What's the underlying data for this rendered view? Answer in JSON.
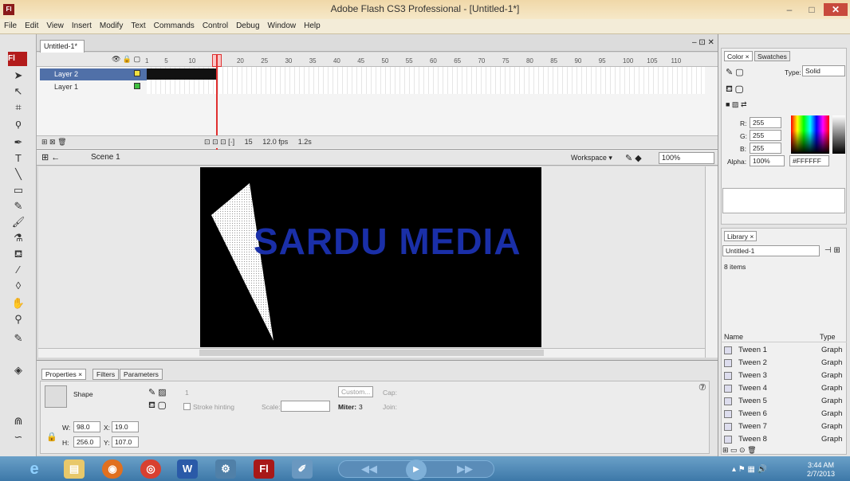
{
  "window": {
    "title": "Adobe Flash CS3 Professional - [Untitled-1*]",
    "logo": "Fl",
    "minimize": "–",
    "maximize": "□",
    "close": "✕"
  },
  "menu": [
    "File",
    "Edit",
    "View",
    "Insert",
    "Modify",
    "Text",
    "Commands",
    "Control",
    "Debug",
    "Window",
    "Help"
  ],
  "tools_logo": "Fl",
  "tools": [
    "arrow-icon",
    "subselect-icon",
    "free-transform-icon",
    "lasso-icon",
    "pen-icon",
    "text-icon",
    "line-icon",
    "rectangle-icon",
    "pencil-icon",
    "brush-icon",
    "ink-bottle-icon",
    "paint-bucket-icon",
    "eyedropper-icon",
    "eraser-icon",
    "hand-icon",
    "zoom-icon"
  ],
  "document": {
    "tab": "Untitled-1*"
  },
  "timeline": {
    "ruler": [
      "1",
      "5",
      "10",
      "15",
      "20",
      "25",
      "30",
      "35",
      "40",
      "45",
      "50",
      "55",
      "60",
      "65",
      "70",
      "75",
      "80",
      "85",
      "90",
      "95",
      "100",
      "105",
      "110"
    ],
    "layers": [
      {
        "name": "Layer 2",
        "selected": true
      },
      {
        "name": "Layer 1",
        "selected": false
      }
    ],
    "current_frame": "15",
    "fps": "12.0 fps",
    "time": "1.2s"
  },
  "scene": {
    "name": "Scene 1",
    "workspace": "Workspace ▾",
    "zoom": "100%"
  },
  "stage": {
    "text": "SARDU MEDIA",
    "text_color": "#1a2fa8",
    "background": "#000000"
  },
  "properties": {
    "tabs": [
      "Properties ×",
      "Filters",
      "Parameters"
    ],
    "type": "Shape",
    "stroke_width": "1",
    "custom_button": "Custom...",
    "cap_label": "Cap:",
    "stroke_hinting": "Stroke hinting",
    "scale_label": "Scale:",
    "miter_label": "Miter:",
    "miter_value": "3",
    "join_label": "Join:",
    "w_label": "W:",
    "w_value": "98.0",
    "x_label": "X:",
    "x_value": "19.0",
    "h_label": "H:",
    "h_value": "256.0",
    "y_label": "Y:",
    "y_value": "107.0"
  },
  "color_panel": {
    "tabs": [
      "Color ×",
      "Swatches"
    ],
    "type_label": "Type:",
    "type_value": "Solid",
    "r_label": "R:",
    "r": "255",
    "g_label": "G:",
    "g": "255",
    "b_label": "B:",
    "b": "255",
    "alpha_label": "Alpha:",
    "alpha": "100%",
    "hex": "#FFFFFF"
  },
  "library": {
    "tab": "Library ×",
    "document": "Untitled-1",
    "count": "8 items",
    "col_name": "Name",
    "col_type": "Type",
    "items": [
      {
        "name": "Tween 1",
        "type": "Graph"
      },
      {
        "name": "Tween 2",
        "type": "Graph"
      },
      {
        "name": "Tween 3",
        "type": "Graph"
      },
      {
        "name": "Tween 4",
        "type": "Graph"
      },
      {
        "name": "Tween 5",
        "type": "Graph"
      },
      {
        "name": "Tween 6",
        "type": "Graph"
      },
      {
        "name": "Tween 7",
        "type": "Graph"
      },
      {
        "name": "Tween 8",
        "type": "Graph"
      }
    ]
  },
  "taskbar": {
    "apps": [
      "ie-icon",
      "explorer-icon",
      "firefox-icon",
      "chrome-icon",
      "word-icon",
      "settings-icon",
      "flash-icon",
      "paint-icon"
    ],
    "word_label": "W",
    "flash_label": "Fl",
    "time": "3:44 AM",
    "date": "2/7/2013"
  }
}
